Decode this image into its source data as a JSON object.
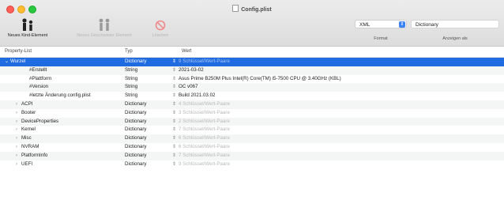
{
  "window": {
    "title": "Config.plist"
  },
  "toolbar": {
    "new_child": "Neues Kind-Element",
    "new_sibling": "Neues Geschwister Element",
    "delete": "Löschen",
    "format_value": "XML",
    "format_label": "Format",
    "view_value": "Dictionary",
    "view_label": "Anzeigen als"
  },
  "columns": {
    "key": "Property-List",
    "type": "Typ",
    "value": "Wert"
  },
  "rows": [
    {
      "key": "Wurzel",
      "type": "Dictionary",
      "value": "9 Schlüssel/Wert-Paare",
      "disclosure": "⌄",
      "muted": true,
      "selected": true
    },
    {
      "key": "#Erstellt",
      "type": "String",
      "value": "2021-03-02",
      "disclosure": "",
      "muted": false
    },
    {
      "key": "#Plattform",
      "type": "String",
      "value": "Asus Prime B250M Plus  Intel(R) Core(TM) i5-7500 CPU @ 3.40GHz (KBL)",
      "disclosure": "",
      "muted": false
    },
    {
      "key": "#Version",
      "type": "String",
      "value": "OC  v067",
      "disclosure": "",
      "muted": false
    },
    {
      "key": "#letzte Änderung config.plist",
      "type": "String",
      "value": "Build 2021.03.02",
      "disclosure": "",
      "muted": false
    },
    {
      "key": "ACPI",
      "type": "Dictionary",
      "value": "4 Schlüssel/Wert-Paare",
      "disclosure": "›",
      "muted": true
    },
    {
      "key": "Booter",
      "type": "Dictionary",
      "value": "3 Schlüssel/Wert-Paare",
      "disclosure": "›",
      "muted": true
    },
    {
      "key": "DeviceProperties",
      "type": "Dictionary",
      "value": "2 Schlüssel/Wert-Paare",
      "disclosure": "›",
      "muted": true
    },
    {
      "key": "Kernel",
      "type": "Dictionary",
      "value": "7 Schlüssel/Wert-Paare",
      "disclosure": "›",
      "muted": true
    },
    {
      "key": "Misc",
      "type": "Dictionary",
      "value": "6 Schlüssel/Wert-Paare",
      "disclosure": "›",
      "muted": true
    },
    {
      "key": "NVRAM",
      "type": "Dictionary",
      "value": "6 Schlüssel/Wert-Paare",
      "disclosure": "›",
      "muted": true
    },
    {
      "key": "PlatformInfo",
      "type": "Dictionary",
      "value": "7 Schlüssel/Wert-Paare",
      "disclosure": "›",
      "muted": true
    },
    {
      "key": "UEFI",
      "type": "Dictionary",
      "value": "9 Schlüssel/Wert-Paare",
      "disclosure": "›",
      "muted": true
    }
  ]
}
